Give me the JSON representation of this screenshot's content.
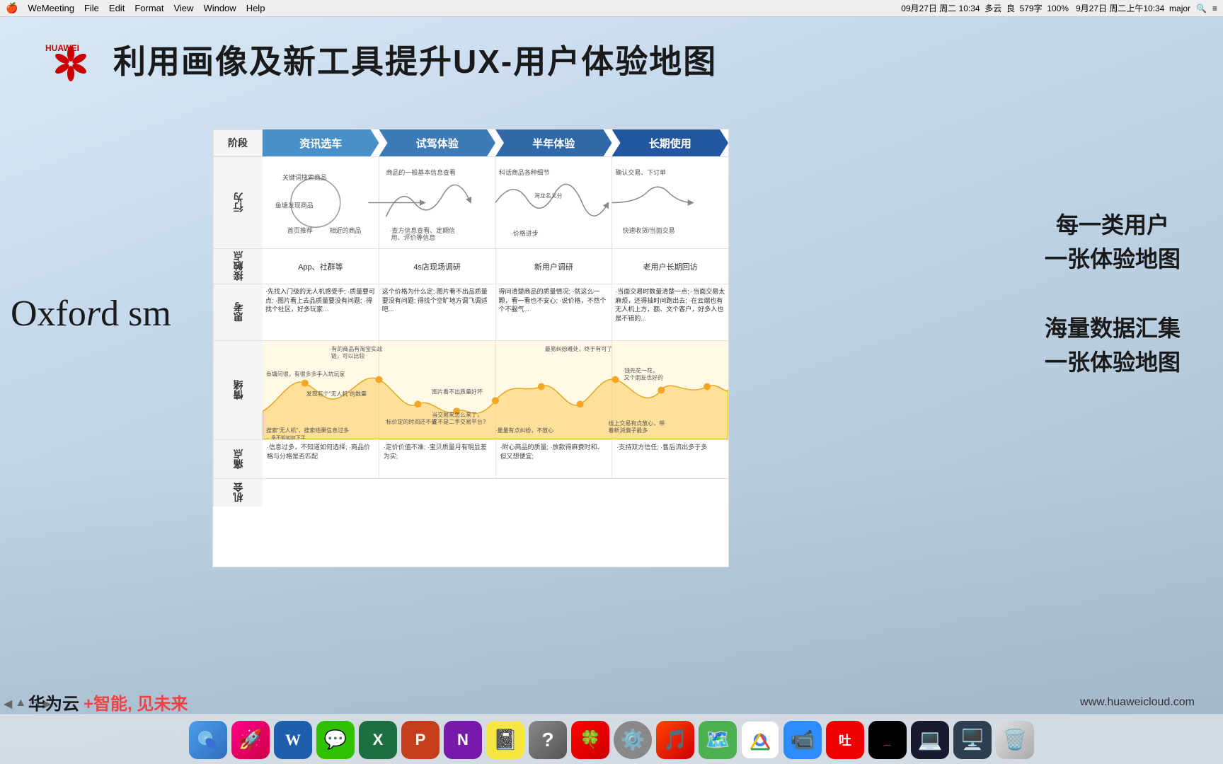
{
  "menubar": {
    "apple": "🍎",
    "app": "WeMeeting",
    "menu_items": [
      "File",
      "Edit",
      "Format",
      "View",
      "Window",
      "Help"
    ],
    "right_info": "09月27日 周二 10:34  多云  良  579字  100%  9月27日 周二上午10:34  major"
  },
  "header": {
    "title": "利用画像及新工具提升UX-用户体验地图"
  },
  "stages": {
    "label": "阶段",
    "phases": [
      "资讯选车",
      "试驾体验",
      "半年体验",
      "长期使用"
    ]
  },
  "sections": {
    "xingwei": {
      "label": "行为"
    },
    "jiechu": {
      "label": "接触点",
      "cells": [
        "App、社群等",
        "4s店现场调研",
        "新用户调研",
        "老用户长期回访"
      ]
    },
    "sikao": {
      "label": "思考",
      "cells": [
        "·先找入门级的无人机感受手;\n·质量要可点;\n·图片看上去品质量要没有问题;\n·得找个社区，好多玩家…",
        "这个价格为什么定;\n图片看不出品质量要没有问题;\n得找个空旷地方调飞调适吧...",
        "得问清楚商品的质量情况;\n·就这么一颗，看一看也不安心;\n·说价格，不然个个不服气...",
        "·当面交易时数量清楚一点;\n·当面交易太麻烦，还得抽时间跑出去;\n·在云端也有无人机上方，额、文个客户，好多人也是不错的..."
      ]
    },
    "qingxu": {
      "label": "情绪"
    },
    "tongdian": {
      "label": "痛点",
      "cells": [
        "·信息过多，不知道如何选择;\n·商品价格与分格是否匹配",
        "·定价价值不准;\n·宝贝质量月有明显差为实;",
        "·附心商品的质量;\n·放款得麻费时和、但又想便宜;",
        "·支持双方信任;\n·售后流出多于多"
      ]
    },
    "jihui": {
      "label": "机会"
    }
  },
  "right_content": {
    "block1_line1": "每一类用户",
    "block1_line2": "一张体验地图",
    "block2_line1": "海量数据汇集",
    "block2_line2": "一张体验地图"
  },
  "oxford_text": "Oxfovd sm",
  "bottom": {
    "brand": "华为云",
    "tagline": "+智能, 见未来",
    "url": "www.huaweicloud.com"
  },
  "dock": {
    "items": [
      "🔵",
      "🚀",
      "📝",
      "💬",
      "📊",
      "📙",
      "📓",
      "🍀",
      "🔧",
      "⚙️",
      "🎵",
      "🗺️",
      "🌐",
      "📹",
      "🍎",
      "🟥",
      "💻",
      "🖥️",
      "🗑️"
    ]
  }
}
